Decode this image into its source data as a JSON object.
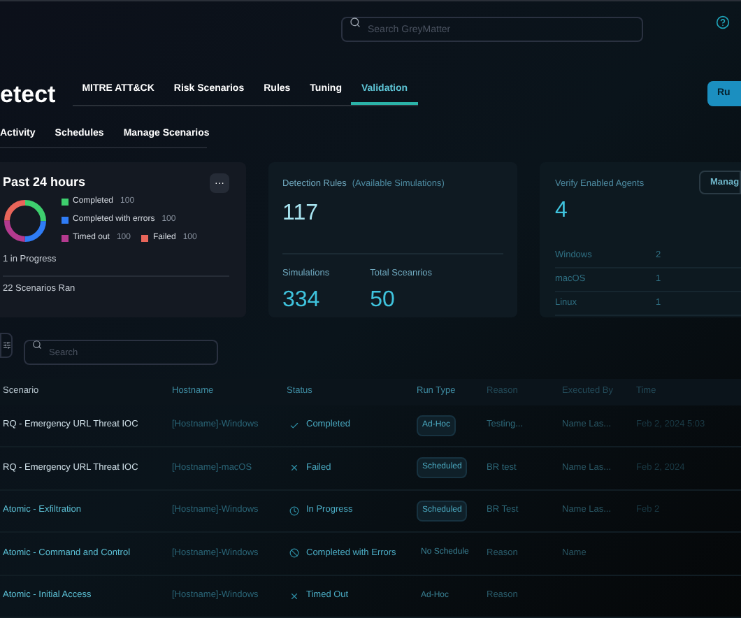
{
  "topbar": {
    "search": {
      "placeholder": "Search GreyMatter"
    }
  },
  "header": {
    "title": "etect",
    "tabs": [
      {
        "label": "MITRE ATT&CK",
        "selected": false
      },
      {
        "label": "Risk Scenarios",
        "selected": false
      },
      {
        "label": "Rules",
        "selected": false
      },
      {
        "label": "Tuning",
        "selected": false
      },
      {
        "label": "Validation",
        "selected": true
      }
    ],
    "run_button": "Ru"
  },
  "subtabs": [
    {
      "label": "Activity"
    },
    {
      "label": "Schedules"
    },
    {
      "label": "Manage Scenarios"
    }
  ],
  "summary": {
    "title": "Past 24 hours",
    "menu": "···",
    "legend": [
      {
        "label": "Completed",
        "count": "100",
        "color": "#3ecf6e"
      },
      {
        "label": "Completed with errors",
        "count": "100",
        "color": "#2f7cf6"
      },
      {
        "label": "Timed out",
        "count": "100",
        "color": "#b43a8f"
      },
      {
        "label": "Failed",
        "count": "100",
        "color": "#e8655a"
      }
    ],
    "in_progress": "1 in Progress",
    "ran": "22 Scenarios Ran"
  },
  "rules": {
    "label": "Detection Rules",
    "note": "(Available Simulations)",
    "value": "117",
    "stats": [
      {
        "label": "Simulations",
        "value": "334"
      },
      {
        "label": "Total Sceanrios",
        "value": "50"
      }
    ]
  },
  "agents": {
    "label": "Verify Enabled Agents",
    "value": "4",
    "button": "Manag",
    "rows": [
      {
        "os": "Windows",
        "count": "2"
      },
      {
        "os": "macOS",
        "count": "1"
      },
      {
        "os": "Linux",
        "count": "1"
      }
    ]
  },
  "filter": {
    "search": {
      "placeholder": "Search"
    }
  },
  "table": {
    "columns": [
      "Scenario",
      "Hostname",
      "Status",
      "Run Type",
      "Reason",
      "Executed By",
      "Time"
    ],
    "rows": [
      {
        "scenario": "RQ - Emergency URL Threat IOC",
        "hostname": "[Hostname]-Windows",
        "status": {
          "kind": "completed",
          "label": "Completed"
        },
        "run_type": {
          "label": "Ad-Hoc",
          "boxed": true
        },
        "reason": "Testing...",
        "executed_by": "Name Las...",
        "time": "Feb 2, 2024 5:03"
      },
      {
        "scenario": "RQ - Emergency URL Threat IOC",
        "hostname": "[Hostname]-macOS",
        "status": {
          "kind": "failed",
          "label": "Failed"
        },
        "run_type": {
          "label": "Scheduled",
          "boxed": true
        },
        "reason": "BR test",
        "executed_by": "Name Las...",
        "time": "Feb 2, 2024"
      },
      {
        "scenario": "Atomic - Exfiltration",
        "hostname": "[Hostname]-Windows",
        "status": {
          "kind": "in_progress",
          "label": "In Progress"
        },
        "run_type": {
          "label": "Scheduled",
          "boxed": true
        },
        "reason": "BR Test",
        "executed_by": "Name Las...",
        "time": "Feb 2"
      },
      {
        "scenario": "Atomic - Command and Control",
        "hostname": "[Hostname]-Windows",
        "status": {
          "kind": "errors",
          "label": "Completed with Errors"
        },
        "run_type": {
          "label": "No Schedule",
          "boxed": false
        },
        "reason": "Reason",
        "executed_by": "Name"
      },
      {
        "scenario": "Atomic - Initial Access",
        "hostname": "[Hostname]-Windows",
        "status": {
          "kind": "timed_out",
          "label": "Timed Out"
        },
        "run_type": {
          "label": "Ad-Hoc",
          "boxed": false
        },
        "reason": "Reason"
      }
    ]
  }
}
